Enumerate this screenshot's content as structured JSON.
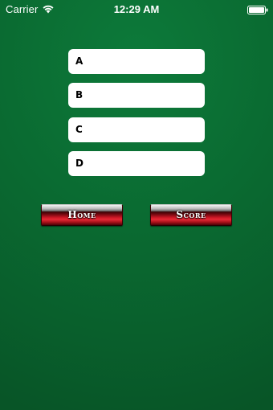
{
  "status_bar": {
    "carrier": "Carrier",
    "time": "12:29 AM",
    "wifi_icon": "wifi-icon",
    "battery_icon": "battery-icon"
  },
  "options": [
    {
      "label": "A"
    },
    {
      "label": "B"
    },
    {
      "label": "C"
    },
    {
      "label": "D"
    }
  ],
  "buttons": {
    "home_label": "Home",
    "score_label": "Score"
  },
  "colors": {
    "background": "#0a6a31",
    "option_background": "#ffffff",
    "button_red": "#d11a28"
  }
}
